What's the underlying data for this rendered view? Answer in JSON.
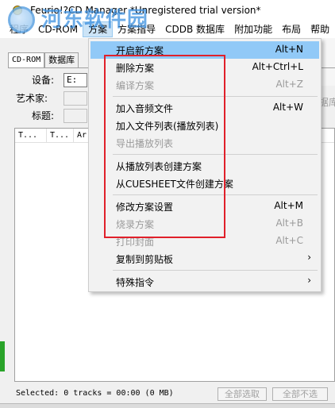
{
  "window": {
    "title": "Feurio!?CD Manager *Unregistered trial version*"
  },
  "watermark": {
    "text": "河东软件园",
    "url": "www.pc0359.cn"
  },
  "menubar": [
    "程序",
    "CD-ROM",
    "方案",
    "方案指导",
    "CDDB 数据库",
    "附加功能",
    "布局",
    "帮助"
  ],
  "tabs": [
    "CD-ROM",
    "数据库"
  ],
  "fields": {
    "device_label": "设备:",
    "device_value": "E:",
    "artist_label": "艺术家:",
    "title_label": "标题:"
  },
  "right_ghost": "据库",
  "list_columns": [
    "T...",
    "T...",
    "Ar"
  ],
  "status": {
    "text": "Selected: 0 tracks = 00:00 (0 MB)",
    "select_all": "全部选取",
    "deselect_all": "全部不选"
  },
  "dropdown": {
    "items": [
      {
        "label": "开启新方案",
        "shortcut": "Alt+N",
        "disabled": false,
        "highlight": true
      },
      {
        "label": "删除方案",
        "shortcut": "Alt+Ctrl+L",
        "disabled": false
      },
      {
        "label": "编译方案",
        "shortcut": "Alt+Z",
        "disabled": true
      },
      {
        "label": "加入音频文件",
        "shortcut": "Alt+W",
        "disabled": false
      },
      {
        "label": "加入文件列表(播放列表)",
        "shortcut": "",
        "disabled": false
      },
      {
        "label": "导出播放列表",
        "shortcut": "",
        "disabled": true
      },
      {
        "label": "从播放列表创建方案",
        "shortcut": "",
        "disabled": false
      },
      {
        "label": "从CUESHEET文件创建方案",
        "shortcut": "",
        "disabled": false
      },
      {
        "label": "修改方案设置",
        "shortcut": "Alt+M",
        "disabled": false
      },
      {
        "label": "烧录方案",
        "shortcut": "Alt+B",
        "disabled": true
      },
      {
        "label": "打印封面",
        "shortcut": "Alt+C",
        "disabled": true
      },
      {
        "label": "复制到剪贴板",
        "shortcut": "",
        "disabled": false,
        "submenu": true
      },
      {
        "label": "特殊指令",
        "shortcut": "",
        "disabled": false,
        "submenu": true
      }
    ]
  },
  "colors": {
    "highlight": "#91c9f7",
    "annotation_box": "#e0202a",
    "disabled_text": "#9a9a9a"
  }
}
